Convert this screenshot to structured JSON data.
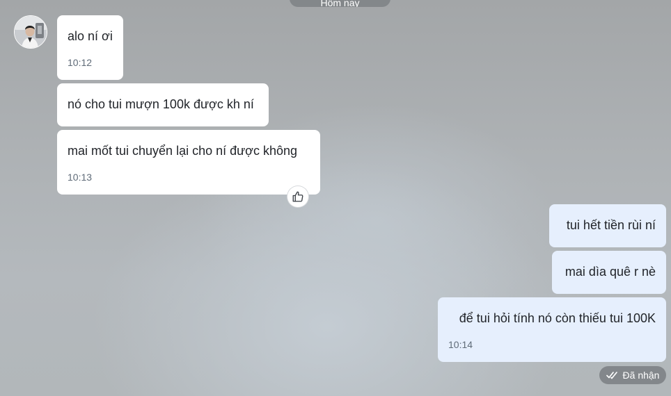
{
  "date_divider": "Hôm nay",
  "contact": {
    "avatar_icon": "user-avatar-icon"
  },
  "messages": [
    {
      "direction": "in",
      "text": "alo ní ơi",
      "time": "10:12"
    },
    {
      "direction": "in",
      "text": "nó cho tui mượn 100k được kh ní",
      "time": ""
    },
    {
      "direction": "in",
      "text": "mai mốt tui chuyển lại cho ní được không",
      "time": "10:13"
    },
    {
      "direction": "out",
      "text": "tui hết tiền rùi ní",
      "time": ""
    },
    {
      "direction": "out",
      "text": "mai dìa quê r nè",
      "time": ""
    },
    {
      "direction": "out",
      "text": "để tui hỏi tính nó còn thiếu tui 100K",
      "time": "10:14"
    }
  ],
  "reaction_icon": "thumbs-up-icon",
  "status": {
    "icon": "double-check-icon",
    "label": "Đã nhận"
  },
  "colors": {
    "incoming_bubble": "#ffffff",
    "outgoing_bubble": "#e6effd",
    "time_text": "#5f6b78"
  }
}
